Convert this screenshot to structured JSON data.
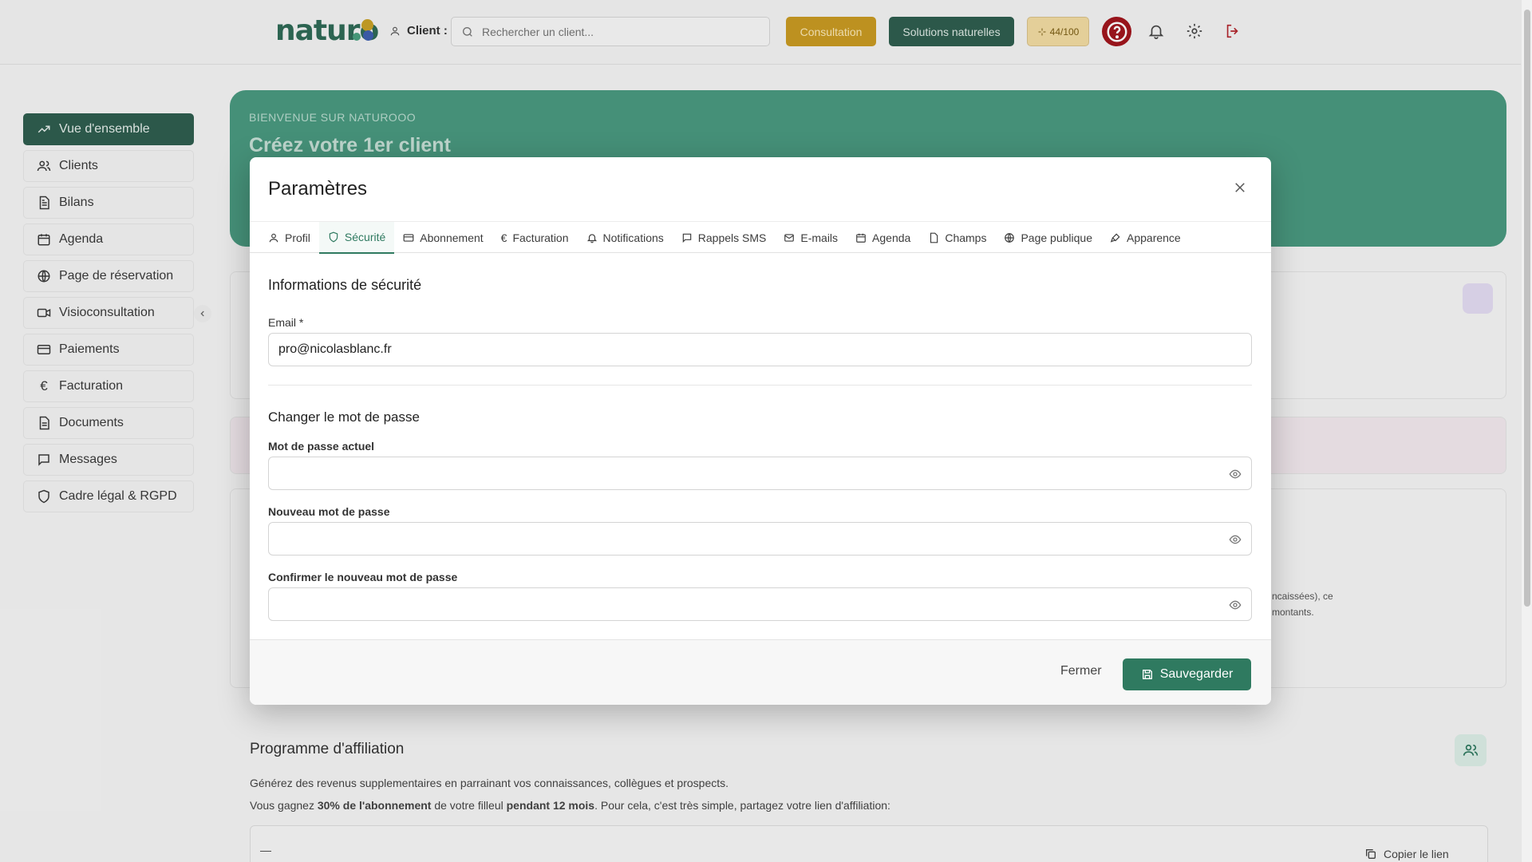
{
  "header": {
    "logo_text": "naturo",
    "client_label": "Client :",
    "search_placeholder": "Rechercher un client...",
    "consultation_label": "Consultation",
    "solutions_label": "Solutions naturelles",
    "credits_label": "44/100"
  },
  "sidebar": {
    "items": [
      {
        "label": "Vue d'ensemble",
        "icon": "trending-up-icon",
        "active": true
      },
      {
        "label": "Clients",
        "icon": "users-icon"
      },
      {
        "label": "Bilans",
        "icon": "file-icon"
      },
      {
        "label": "Agenda",
        "icon": "calendar-icon"
      },
      {
        "label": "Page de réservation",
        "icon": "globe-icon"
      },
      {
        "label": "Visioconsultation",
        "icon": "video-icon"
      },
      {
        "label": "Paiements",
        "icon": "credit-card-icon"
      },
      {
        "label": "Facturation",
        "icon": "euro-icon"
      },
      {
        "label": "Documents",
        "icon": "document-icon"
      },
      {
        "label": "Messages",
        "icon": "message-icon"
      },
      {
        "label": "Cadre légal & RGPD",
        "icon": "shield-icon"
      }
    ]
  },
  "background": {
    "hero_kicker": "BIENVENUE SUR NATUROOO",
    "hero_title": "Créez votre 1er client",
    "affiliation_title": "Programme d'affiliation",
    "affiliation_line1": "Générez des revenus supplementaires en parrainant vos connaissances, collègues et prospects.",
    "affiliation_line2_a": "Vous gagnez ",
    "affiliation_line2_b": "30% de l'abonnement",
    "affiliation_line2_c": " de votre filleul ",
    "affiliation_line2_d": "pendant 12 mois",
    "affiliation_line2_e": ". Pour cela, c'est très simple, partagez votre lien d'affiliation:",
    "affiliation_link_value": "—",
    "copy_link_label": "Copier le lien",
    "partial_text_1": "ncaissées), ce",
    "partial_text_2": "montants."
  },
  "modal": {
    "title": "Paramètres",
    "tabs": [
      {
        "label": "Profil",
        "icon": "user-icon"
      },
      {
        "label": "Sécurité",
        "icon": "shield-icon",
        "active": true
      },
      {
        "label": "Abonnement",
        "icon": "credit-card-icon"
      },
      {
        "label": "Facturation",
        "icon": "euro-icon"
      },
      {
        "label": "Notifications",
        "icon": "bell-icon"
      },
      {
        "label": "Rappels SMS",
        "icon": "message-icon"
      },
      {
        "label": "E-mails",
        "icon": "mail-icon"
      },
      {
        "label": "Agenda",
        "icon": "calendar-icon"
      },
      {
        "label": "Champs",
        "icon": "file-icon"
      },
      {
        "label": "Page publique",
        "icon": "globe-icon"
      },
      {
        "label": "Apparence",
        "icon": "brush-icon"
      }
    ],
    "security_title": "Informations de sécurité",
    "email_label": "Email *",
    "email_value": "pro@nicolasblanc.fr",
    "password_section_title": "Changer le mot de passe",
    "current_password_label": "Mot de passe actuel",
    "new_password_label": "Nouveau mot de passe",
    "confirm_password_label": "Confirmer le nouveau mot de passe",
    "close_label": "Fermer",
    "save_label": "Sauvegarder"
  },
  "colors": {
    "brand_green": "#2f5e4f",
    "accent_green": "#2f7a60",
    "gold": "#c99b23",
    "help_red": "#a1161d"
  }
}
